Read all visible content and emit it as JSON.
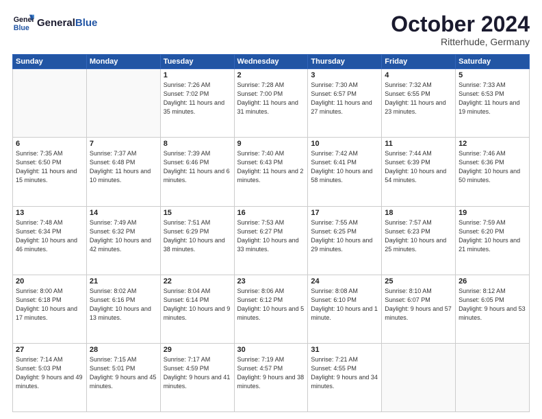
{
  "header": {
    "logo_line1": "General",
    "logo_line2": "Blue",
    "month": "October 2024",
    "location": "Ritterhude, Germany"
  },
  "weekdays": [
    "Sunday",
    "Monday",
    "Tuesday",
    "Wednesday",
    "Thursday",
    "Friday",
    "Saturday"
  ],
  "weeks": [
    [
      {
        "day": "",
        "detail": ""
      },
      {
        "day": "",
        "detail": ""
      },
      {
        "day": "1",
        "detail": "Sunrise: 7:26 AM\nSunset: 7:02 PM\nDaylight: 11 hours and 35 minutes."
      },
      {
        "day": "2",
        "detail": "Sunrise: 7:28 AM\nSunset: 7:00 PM\nDaylight: 11 hours and 31 minutes."
      },
      {
        "day": "3",
        "detail": "Sunrise: 7:30 AM\nSunset: 6:57 PM\nDaylight: 11 hours and 27 minutes."
      },
      {
        "day": "4",
        "detail": "Sunrise: 7:32 AM\nSunset: 6:55 PM\nDaylight: 11 hours and 23 minutes."
      },
      {
        "day": "5",
        "detail": "Sunrise: 7:33 AM\nSunset: 6:53 PM\nDaylight: 11 hours and 19 minutes."
      }
    ],
    [
      {
        "day": "6",
        "detail": "Sunrise: 7:35 AM\nSunset: 6:50 PM\nDaylight: 11 hours and 15 minutes."
      },
      {
        "day": "7",
        "detail": "Sunrise: 7:37 AM\nSunset: 6:48 PM\nDaylight: 11 hours and 10 minutes."
      },
      {
        "day": "8",
        "detail": "Sunrise: 7:39 AM\nSunset: 6:46 PM\nDaylight: 11 hours and 6 minutes."
      },
      {
        "day": "9",
        "detail": "Sunrise: 7:40 AM\nSunset: 6:43 PM\nDaylight: 11 hours and 2 minutes."
      },
      {
        "day": "10",
        "detail": "Sunrise: 7:42 AM\nSunset: 6:41 PM\nDaylight: 10 hours and 58 minutes."
      },
      {
        "day": "11",
        "detail": "Sunrise: 7:44 AM\nSunset: 6:39 PM\nDaylight: 10 hours and 54 minutes."
      },
      {
        "day": "12",
        "detail": "Sunrise: 7:46 AM\nSunset: 6:36 PM\nDaylight: 10 hours and 50 minutes."
      }
    ],
    [
      {
        "day": "13",
        "detail": "Sunrise: 7:48 AM\nSunset: 6:34 PM\nDaylight: 10 hours and 46 minutes."
      },
      {
        "day": "14",
        "detail": "Sunrise: 7:49 AM\nSunset: 6:32 PM\nDaylight: 10 hours and 42 minutes."
      },
      {
        "day": "15",
        "detail": "Sunrise: 7:51 AM\nSunset: 6:29 PM\nDaylight: 10 hours and 38 minutes."
      },
      {
        "day": "16",
        "detail": "Sunrise: 7:53 AM\nSunset: 6:27 PM\nDaylight: 10 hours and 33 minutes."
      },
      {
        "day": "17",
        "detail": "Sunrise: 7:55 AM\nSunset: 6:25 PM\nDaylight: 10 hours and 29 minutes."
      },
      {
        "day": "18",
        "detail": "Sunrise: 7:57 AM\nSunset: 6:23 PM\nDaylight: 10 hours and 25 minutes."
      },
      {
        "day": "19",
        "detail": "Sunrise: 7:59 AM\nSunset: 6:20 PM\nDaylight: 10 hours and 21 minutes."
      }
    ],
    [
      {
        "day": "20",
        "detail": "Sunrise: 8:00 AM\nSunset: 6:18 PM\nDaylight: 10 hours and 17 minutes."
      },
      {
        "day": "21",
        "detail": "Sunrise: 8:02 AM\nSunset: 6:16 PM\nDaylight: 10 hours and 13 minutes."
      },
      {
        "day": "22",
        "detail": "Sunrise: 8:04 AM\nSunset: 6:14 PM\nDaylight: 10 hours and 9 minutes."
      },
      {
        "day": "23",
        "detail": "Sunrise: 8:06 AM\nSunset: 6:12 PM\nDaylight: 10 hours and 5 minutes."
      },
      {
        "day": "24",
        "detail": "Sunrise: 8:08 AM\nSunset: 6:10 PM\nDaylight: 10 hours and 1 minute."
      },
      {
        "day": "25",
        "detail": "Sunrise: 8:10 AM\nSunset: 6:07 PM\nDaylight: 9 hours and 57 minutes."
      },
      {
        "day": "26",
        "detail": "Sunrise: 8:12 AM\nSunset: 6:05 PM\nDaylight: 9 hours and 53 minutes."
      }
    ],
    [
      {
        "day": "27",
        "detail": "Sunrise: 7:14 AM\nSunset: 5:03 PM\nDaylight: 9 hours and 49 minutes."
      },
      {
        "day": "28",
        "detail": "Sunrise: 7:15 AM\nSunset: 5:01 PM\nDaylight: 9 hours and 45 minutes."
      },
      {
        "day": "29",
        "detail": "Sunrise: 7:17 AM\nSunset: 4:59 PM\nDaylight: 9 hours and 41 minutes."
      },
      {
        "day": "30",
        "detail": "Sunrise: 7:19 AM\nSunset: 4:57 PM\nDaylight: 9 hours and 38 minutes."
      },
      {
        "day": "31",
        "detail": "Sunrise: 7:21 AM\nSunset: 4:55 PM\nDaylight: 9 hours and 34 minutes."
      },
      {
        "day": "",
        "detail": ""
      },
      {
        "day": "",
        "detail": ""
      }
    ]
  ]
}
